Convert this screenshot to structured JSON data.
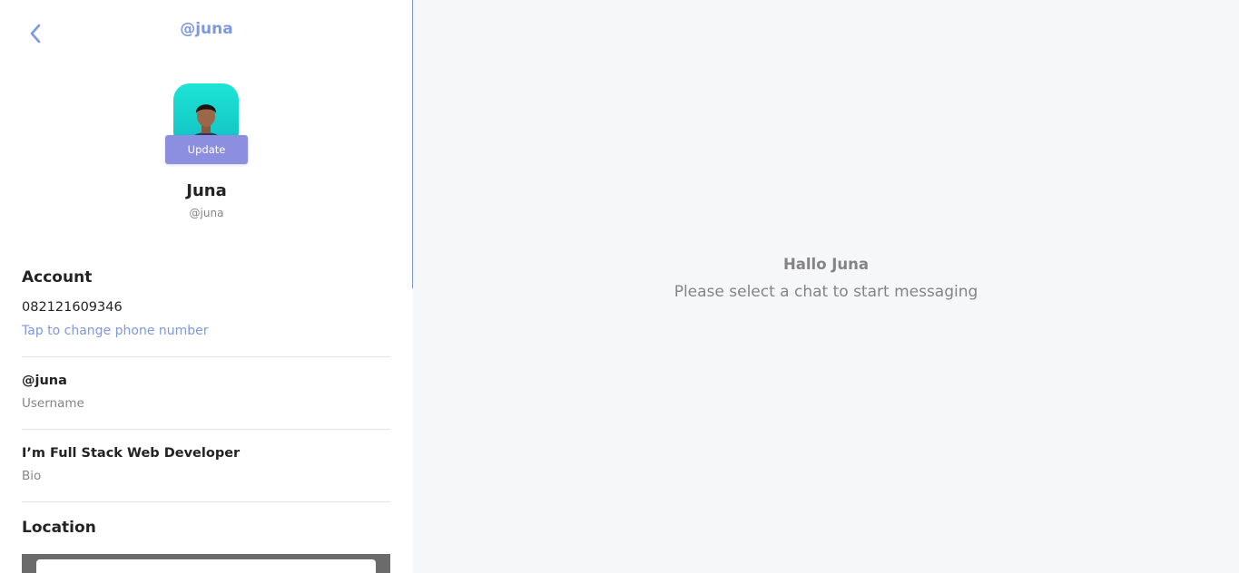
{
  "header": {
    "back_icon": "chevron-left-icon",
    "title": "@juna"
  },
  "profile": {
    "update_label": "Update",
    "name": "Juna",
    "handle": "@juna"
  },
  "account": {
    "title": "Account",
    "phone": "082121609346",
    "change_phone_label": "Tap to change phone number"
  },
  "username": {
    "value": "@juna",
    "label": "Username"
  },
  "bio": {
    "value": "I’m Full Stack Web Developer",
    "label": "Bio"
  },
  "location": {
    "title": "Location"
  },
  "main": {
    "greeting": "Hallo Juna",
    "subtitle": "Please select a chat to start messaging"
  },
  "colors": {
    "accent": "#7e98df",
    "button": "#8c8fe0",
    "main_bg": "#f6f7f9"
  }
}
